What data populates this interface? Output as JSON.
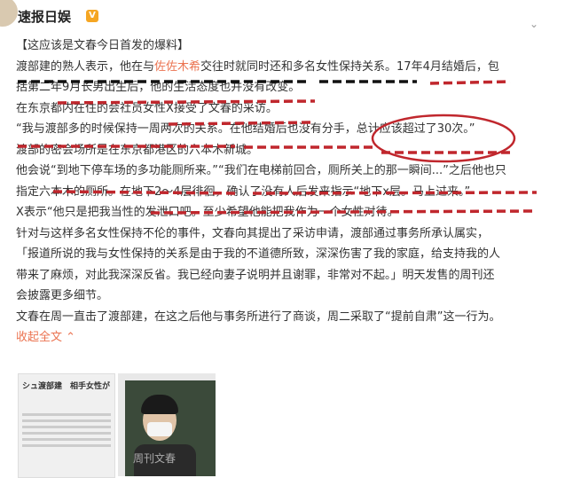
{
  "header": {
    "nickname": "速报日娱",
    "verified_icon": "v-badge-icon",
    "menu_icon": "chevron-down-icon"
  },
  "post": {
    "lines": [
      "【这应该是文春今日首发的爆料】",
      [
        "渡部建的熟人表示，他在与",
        "佐佐木希",
        "交往时就同时还和多名女性保持关系。17年4月结婚后，包"
      ],
      "括第二年9月长男出生后，他的生活态度也并没有改变。",
      "在东京都内在住的会社员女性X接受了文春的采访。",
      "“我与渡部多的时候保持一周两次的关系。在他结婚后也没有分手，总计应该超过了30次。”",
      "渡部的密会场所是在东京都港区的六本木新城。",
      "他会说“到地下停车场的多功能厕所来。”“我们在电梯前回合，厕所关上的那一瞬间...”之后他也只",
      "指定六本木的厕所。在地下2～4层徘徊，确认了没有人后发来指示“地下x层。马上过来。”",
      "X表示“他只是把我当性的发泄口吧。至少希望他能把我作为一个女性对待。",
      "针对与这样多名女性保持不伦的事件，文春向其提出了采访申请，渡部通过事务所承认属实，",
      "「报道所说的我与女性保持的关系是由于我的不道德所致，深深伤害了我的家庭，给支持我的人",
      "带来了麻烦，对此我深深反省。我已经向妻子说明并且谢罪，非常对不起。」明天发售的周刊还",
      "会披露更多细节。",
      "文春在周一直击了渡部建，在这之后他与事务所进行了商谈，周二采取了“提前自肃”这一行为。"
    ],
    "expand_label": "收起全文",
    "expand_icon": "chevron-up-icon"
  },
  "media": {
    "thumb_title": "シュ渡部建　相手女性が「“性の",
    "watermark": "周刊文春"
  },
  "colors": {
    "link": "#eb7350",
    "annotation": "#c0272d"
  }
}
